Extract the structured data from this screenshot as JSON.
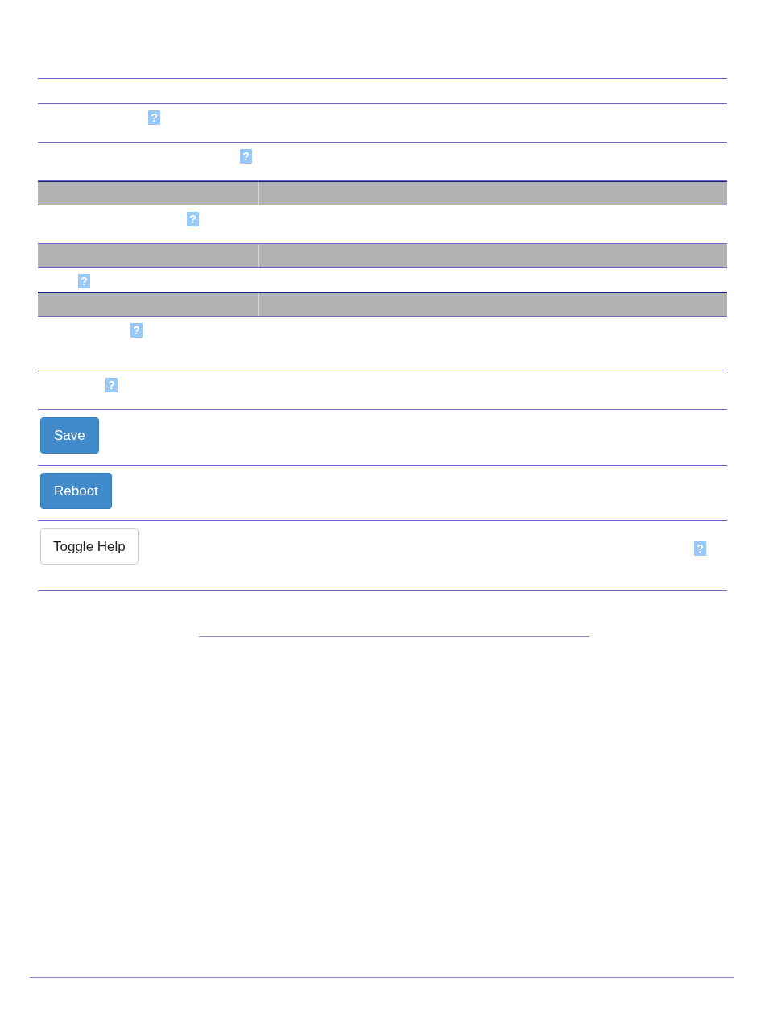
{
  "rows": [
    {
      "kind": "field",
      "help": "?"
    },
    {
      "kind": "field",
      "help": "?"
    },
    {
      "kind": "header"
    },
    {
      "kind": "field",
      "help": "?"
    },
    {
      "kind": "header"
    },
    {
      "kind": "field",
      "help": "?"
    },
    {
      "kind": "header"
    },
    {
      "kind": "field",
      "help": "?"
    },
    {
      "kind": "field",
      "help": "?"
    },
    {
      "kind": "button",
      "label": "Save"
    },
    {
      "kind": "button",
      "label": "Reboot"
    },
    {
      "kind": "plain-button",
      "label": "Toggle Help",
      "help": "?"
    }
  ]
}
